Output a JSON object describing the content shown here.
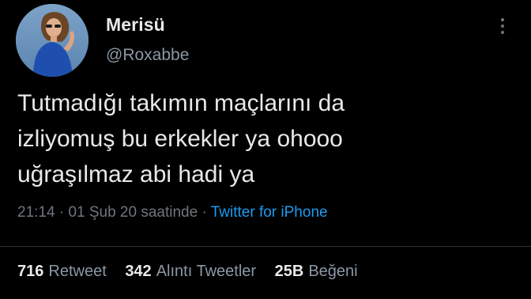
{
  "tweet": {
    "display_name": "Merisü",
    "handle": "@Roxabbe",
    "text_lines": [
      "Tutmadığı takımın maçlarını da",
      "izliyomuş bu erkekler ya ohooo",
      "uğraşılmaz abi hadi ya"
    ],
    "time": "21:14",
    "date": "01 Şub 20 saatinde",
    "separator": "·",
    "source": "Twitter for iPhone"
  },
  "stats": {
    "retweets": {
      "count": "716",
      "label": "Retweet"
    },
    "quotes": {
      "count": "342",
      "label": "Alıntı Tweetler"
    },
    "likes": {
      "count": "25B",
      "label": "Beğeni"
    }
  },
  "icons": {
    "avatar": "profile-photo",
    "more": "more-vertical-icon"
  },
  "colors": {
    "background": "#000000",
    "text": "#e7e9ea",
    "secondary": "#8b98a5",
    "link": "#1d9bf0",
    "divider": "#2f3336"
  }
}
